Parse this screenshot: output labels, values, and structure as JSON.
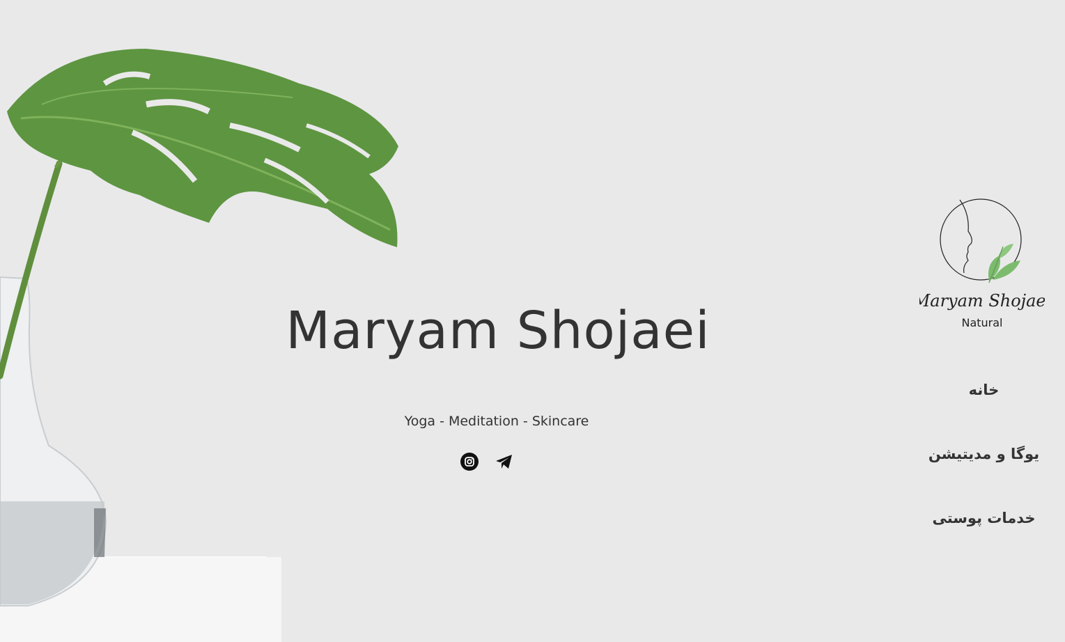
{
  "hero": {
    "title": "Maryam Shojaei",
    "tagline": "Yoga - Meditation - Skincare"
  },
  "socials": [
    {
      "icon": "instagram-icon"
    },
    {
      "icon": "telegram-icon"
    }
  ],
  "logo": {
    "signature": "Maryam Shojaei",
    "subtitle": "Natural",
    "accent": "#7cbb6d"
  },
  "nav": {
    "items": [
      {
        "label": "خانه"
      },
      {
        "label": "یوگا و مدیتیشن"
      },
      {
        "label": "خدمات پوستی"
      }
    ]
  },
  "colors": {
    "background": "#e9e9ea",
    "text": "#333333",
    "leaf": "#4f8a37"
  }
}
